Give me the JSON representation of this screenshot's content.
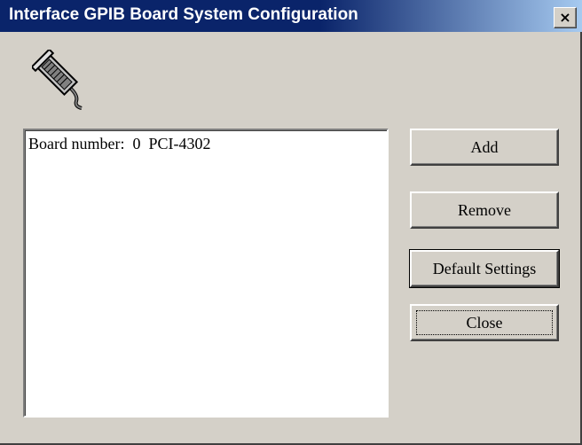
{
  "window": {
    "title": "Interface GPIB Board System Configuration",
    "close_glyph": "×"
  },
  "icon": {
    "name": "gpib-cable-icon"
  },
  "board_list": {
    "items": [
      {
        "label": "Board number:  0  PCI-4302"
      }
    ]
  },
  "buttons": {
    "add": "Add",
    "remove": "Remove",
    "default_settings": "Default Settings",
    "close": "Close"
  }
}
